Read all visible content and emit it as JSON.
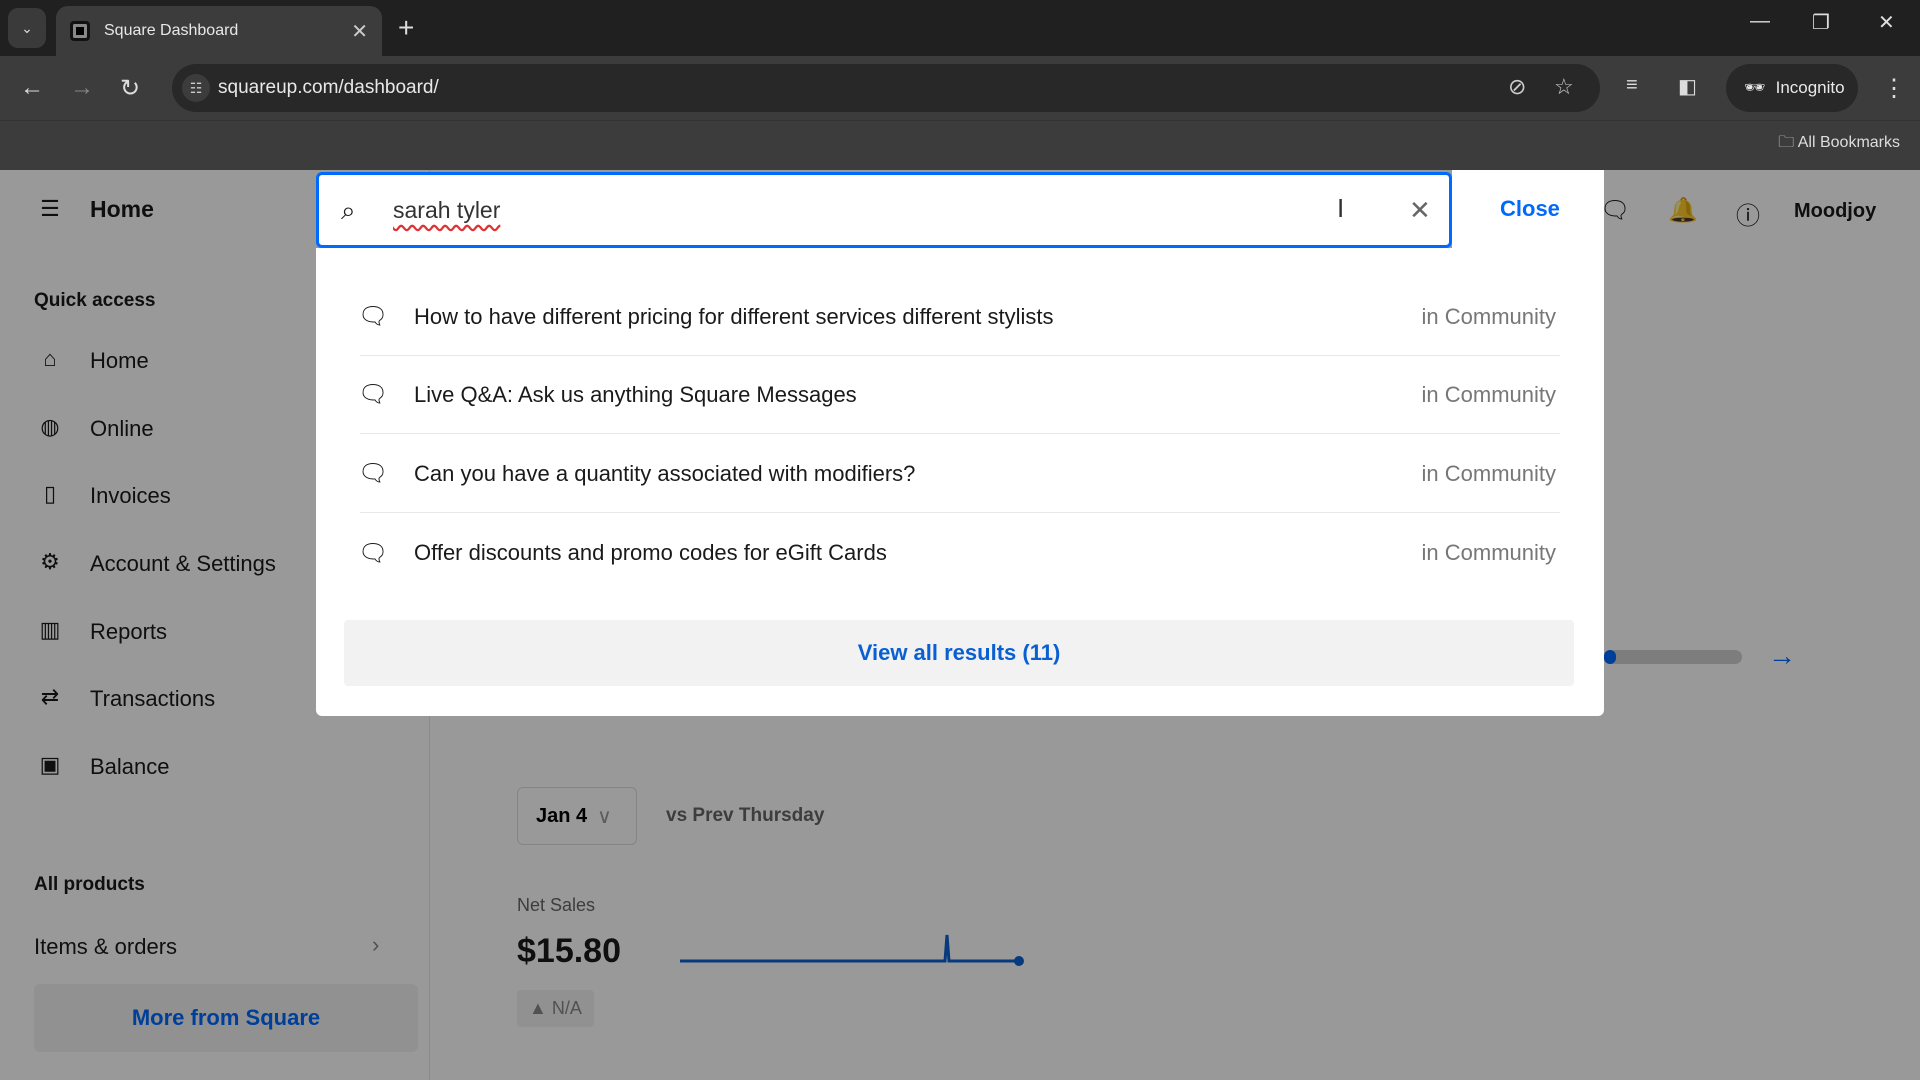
{
  "browser": {
    "tab_title": "Square Dashboard",
    "url": "squareup.com/dashboard/",
    "incognito_label": "Incognito",
    "bookmarks_label": "All Bookmarks"
  },
  "header": {
    "title": "Home",
    "account": "Moodjoy"
  },
  "sidebar": {
    "quick_access": "Quick access",
    "items": [
      {
        "label": "Home",
        "icon": "home-icon"
      },
      {
        "label": "Online",
        "icon": "globe-icon"
      },
      {
        "label": "Invoices",
        "icon": "invoice-icon"
      },
      {
        "label": "Account & Settings",
        "icon": "gear-icon"
      },
      {
        "label": "Reports",
        "icon": "bar-chart-icon"
      },
      {
        "label": "Transactions",
        "icon": "swap-icon"
      },
      {
        "label": "Balance",
        "icon": "cash-icon"
      }
    ],
    "all_products": "All products",
    "items_orders": "Items & orders",
    "more": "More from Square"
  },
  "main": {
    "date": "Jan 4",
    "compare": "vs Prev Thursday",
    "net_sales_label": "Net Sales",
    "net_sales": "$15.80",
    "change": "▲ N/A"
  },
  "search": {
    "query": "sarah tyler",
    "close": "Close",
    "results": [
      {
        "title": "How to have different pricing for different services different stylists",
        "source": "in Community"
      },
      {
        "title": "Live Q&A: Ask us anything Square Messages",
        "source": "in Community"
      },
      {
        "title": "Can you have a quantity associated with modifiers?",
        "source": "in Community"
      },
      {
        "title": "Offer discounts and promo codes for eGift Cards",
        "source": "in Community"
      }
    ],
    "view_all": "View all results (11)"
  },
  "colors": {
    "accent": "#006aff"
  }
}
